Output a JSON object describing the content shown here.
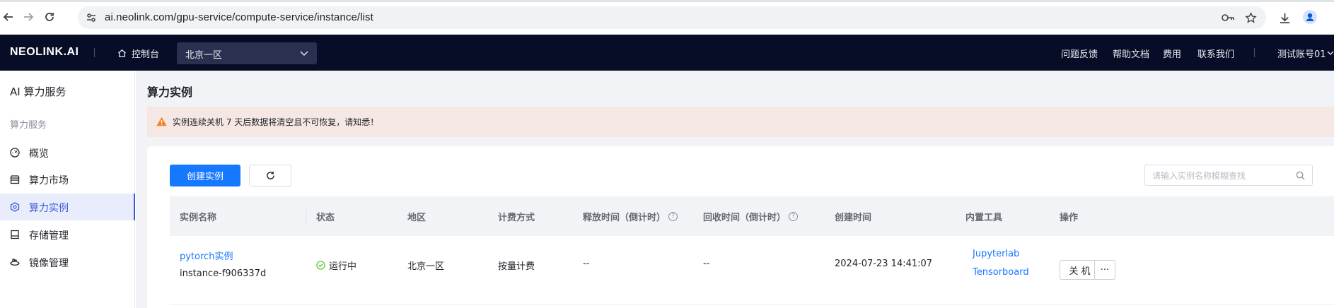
{
  "browser": {
    "url": "ai.neolink.com/gpu-service/compute-service/instance/list"
  },
  "header": {
    "logo": "NEOLINK.AI",
    "console": "控制台",
    "region": "北京一区",
    "links": [
      "问题反馈",
      "帮助文档",
      "费用",
      "联系我们"
    ],
    "account": "测试账号01"
  },
  "sidebar": {
    "title": "AI 算力服务",
    "group": "算力服务",
    "items": [
      {
        "label": "概览",
        "icon": "dashboard-icon"
      },
      {
        "label": "算力市场",
        "icon": "store-icon"
      },
      {
        "label": "算力实例",
        "icon": "instance-icon",
        "active": true
      },
      {
        "label": "存储管理",
        "icon": "storage-icon"
      },
      {
        "label": "镜像管理",
        "icon": "image-icon"
      }
    ]
  },
  "main": {
    "title": "算力实例",
    "alert": "实例连续关机 7 天后数据将清空且不可恢复，请知悉！",
    "create_button": "创建实例",
    "search_placeholder": "请输入实例名称模糊查找",
    "columns": [
      "实例名称",
      "状态",
      "地区",
      "计费方式",
      "释放时间（倒计时）",
      "回收时间（倒计时）",
      "创建时间",
      "内置工具",
      "操作"
    ],
    "rows": [
      {
        "name": "pytorch实例",
        "id": "instance-f906337d",
        "status": "运行中",
        "region": "北京一区",
        "billing": "按量计费",
        "release_time": "--",
        "recycle_time": "--",
        "created": "2024-07-23 14:41:07",
        "tools": [
          "Jupyterlab",
          "Tensorboard"
        ],
        "action_shutdown": "关 机",
        "action_more": "···"
      }
    ]
  },
  "colors": {
    "appbar_bg": "#070d26",
    "primary": "#1677ff",
    "active_nav": "#3b5bdb",
    "alert_bg": "#f5e7e3",
    "warning": "#f5831f",
    "success": "#52c41a"
  }
}
